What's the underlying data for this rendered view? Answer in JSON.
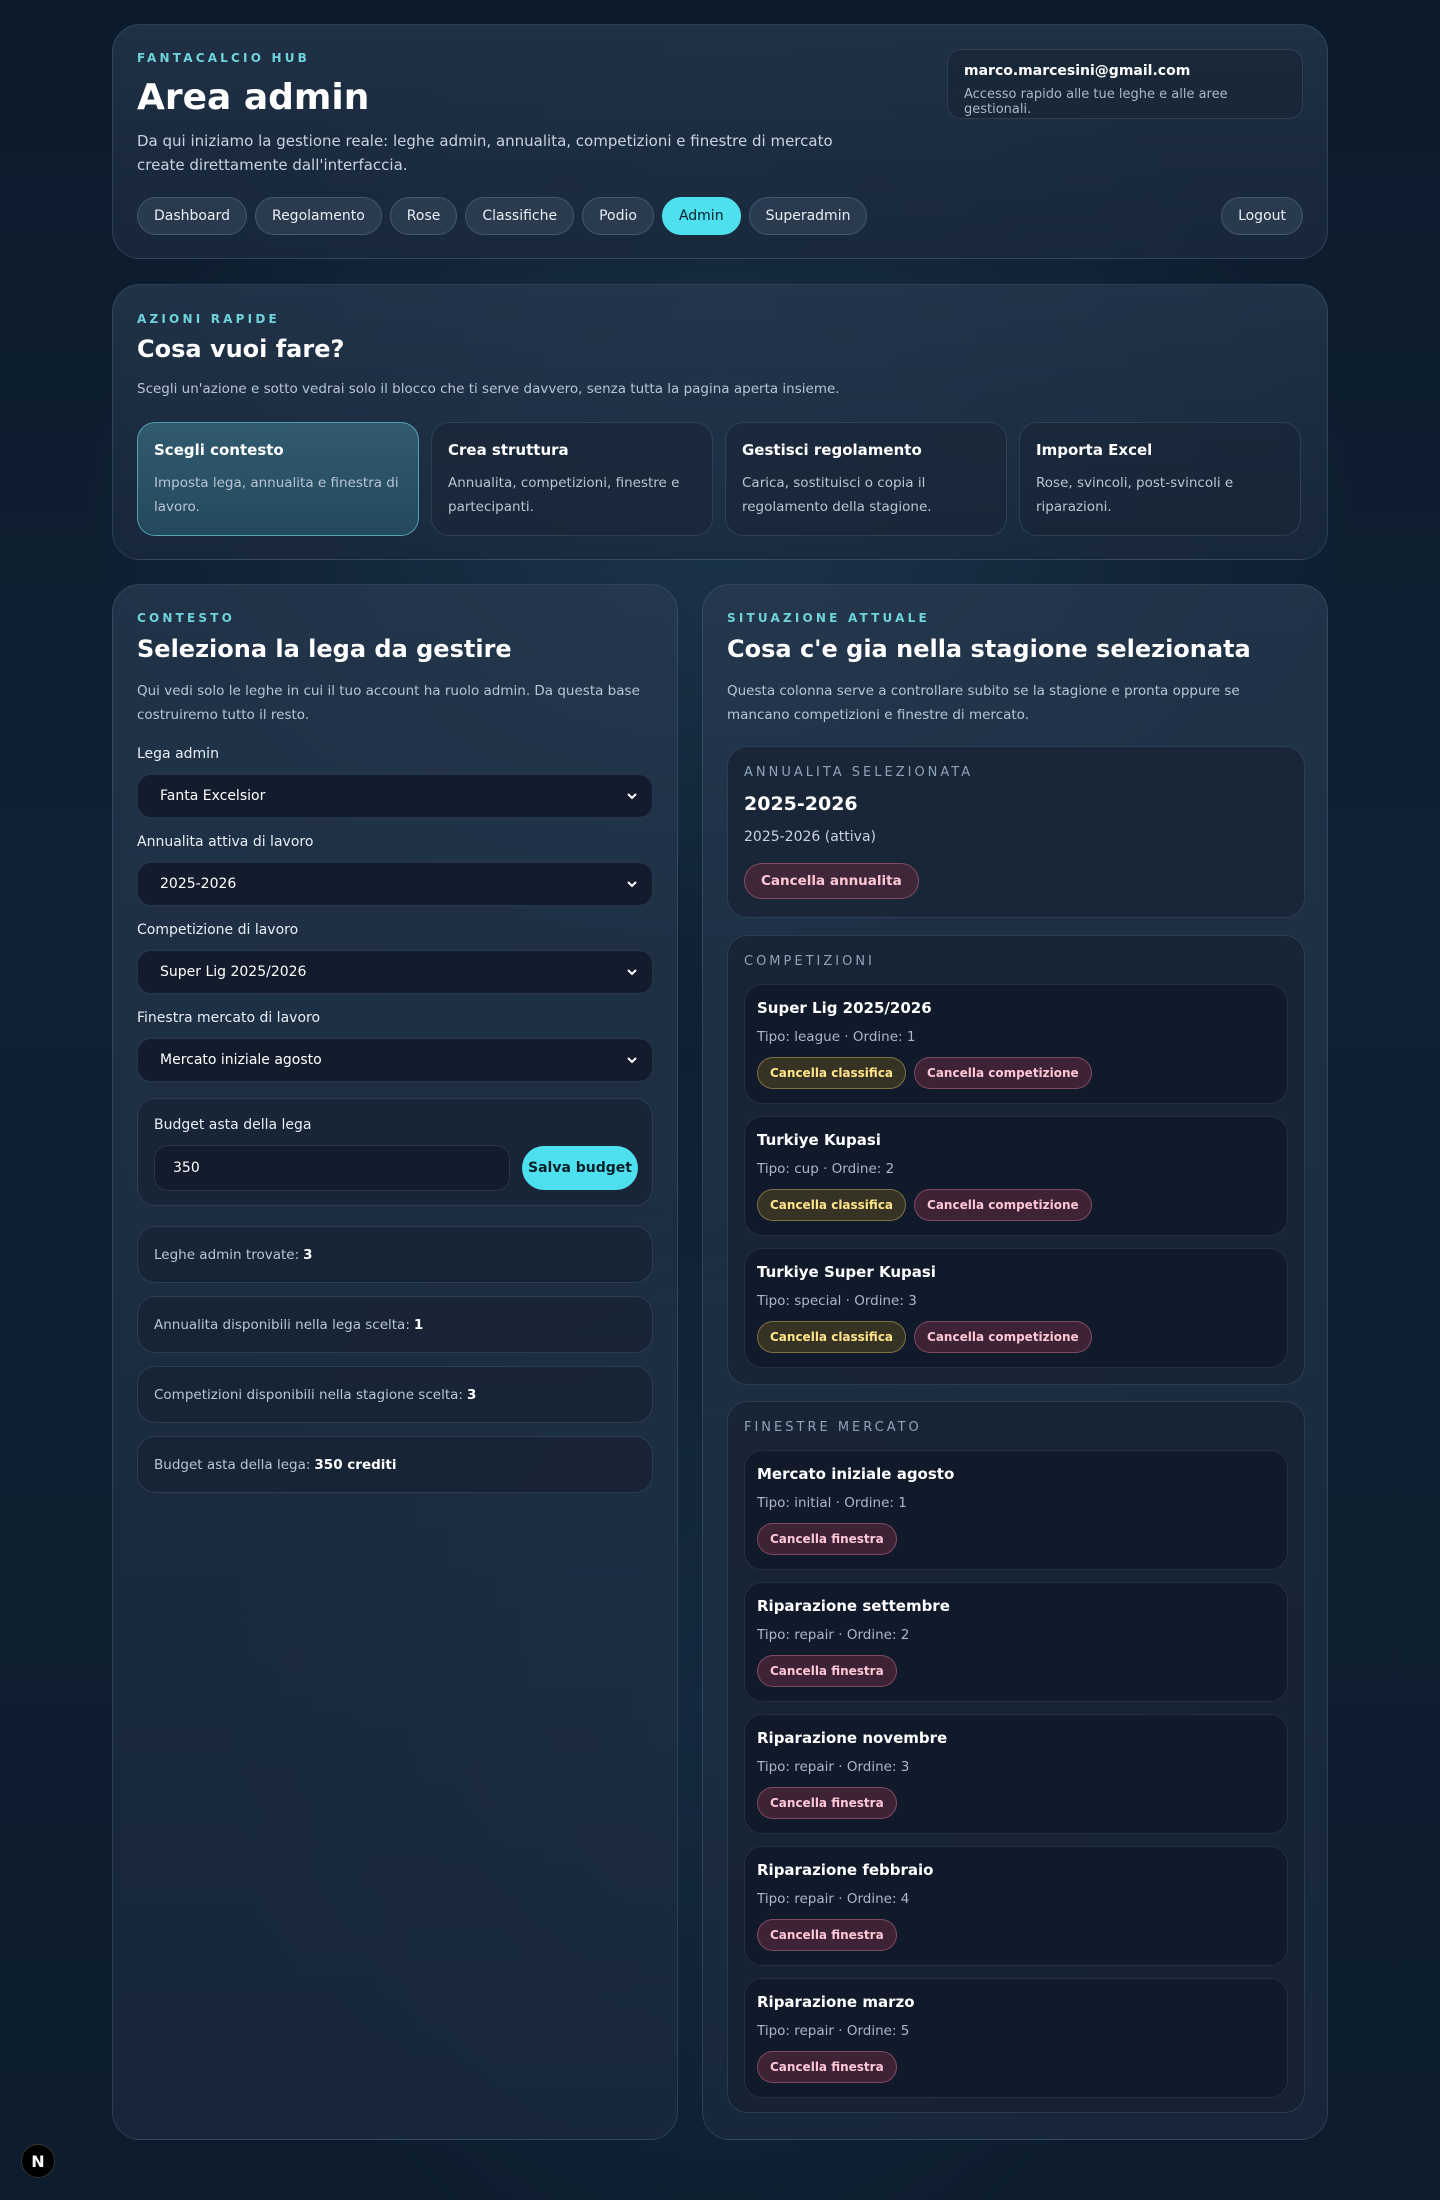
{
  "header": {
    "eyebrow": "FANTACALCIO HUB",
    "title": "Area admin",
    "description": "Da qui iniziamo la gestione reale: leghe admin, annualita, competizioni e finestre di mercato create direttamente dall'interfaccia.",
    "account_email": "marco.marcesini@gmail.com",
    "account_sub": "Accesso rapido alle tue leghe e alle aree gestionali.",
    "nav": [
      "Dashboard",
      "Regolamento",
      "Rose",
      "Classifiche",
      "Podio",
      "Admin",
      "Superadmin"
    ],
    "active_nav": "Admin",
    "logout_label": "Logout"
  },
  "quick": {
    "eyebrow": "AZIONI RAPIDE",
    "title": "Cosa vuoi fare?",
    "description": "Scegli un'azione e sotto vedrai solo il blocco che ti serve davvero, senza tutta la pagina aperta insieme.",
    "cards": [
      {
        "title": "Scegli contesto",
        "desc": "Imposta lega, annualita e finestra di lavoro."
      },
      {
        "title": "Crea struttura",
        "desc": "Annualita, competizioni, finestre e partecipanti."
      },
      {
        "title": "Gestisci regolamento",
        "desc": "Carica, sostituisci o copia il regolamento della stagione."
      },
      {
        "title": "Importa Excel",
        "desc": "Rose, svincoli, post-svincoli e riparazioni."
      }
    ]
  },
  "context": {
    "eyebrow": "CONTESTO",
    "title": "Seleziona la lega da gestire",
    "description": "Qui vedi solo le leghe in cui il tuo account ha ruolo admin. Da questa base costruiremo tutto il resto.",
    "league_label": "Lega admin",
    "league_value": "Fanta Excelsior",
    "annuality_label": "Annualita attiva di lavoro",
    "annuality_value": "2025-2026",
    "competition_label": "Competizione di lavoro",
    "competition_value": "Super Lig 2025/2026",
    "window_label": "Finestra mercato di lavoro",
    "window_value": "Mercato iniziale agosto",
    "budget_label": "Budget asta della lega",
    "budget_value": "350",
    "save_budget_label": "Salva budget",
    "stats": [
      {
        "label": "Leghe admin trovate:",
        "value": "3"
      },
      {
        "label": "Annualita disponibili nella lega scelta:",
        "value": "1"
      },
      {
        "label": "Competizioni disponibili nella stagione scelta:",
        "value": "3"
      },
      {
        "label": "Budget asta della lega:",
        "value": "350 crediti"
      }
    ]
  },
  "situation": {
    "eyebrow": "SITUAZIONE ATTUALE",
    "title": "Cosa c'e gia nella stagione selezionata",
    "description": "Questa colonna serve a controllare subito se la stagione e pronta oppure se mancano competizioni e finestre di mercato.",
    "annuality": {
      "eyebrow": "ANNUALITA SELEZIONATA",
      "year": "2025-2026",
      "sub": "2025-2026 (attiva)",
      "delete_label": "Cancella annualita"
    },
    "competitions_eyebrow": "COMPETIZIONI",
    "competitions": [
      {
        "name": "Super Lig 2025/2026",
        "meta": "Tipo: league · Ordine: 1"
      },
      {
        "name": "Turkiye Kupasi",
        "meta": "Tipo: cup · Ordine: 2"
      },
      {
        "name": "Turkiye Super Kupasi",
        "meta": "Tipo: special · Ordine: 3"
      }
    ],
    "delete_standings_label": "Cancella classifica",
    "delete_competition_label": "Cancella competizione",
    "windows_eyebrow": "FINESTRE MERCATO",
    "windows": [
      {
        "name": "Mercato iniziale agosto",
        "meta": "Tipo: initial · Ordine: 1"
      },
      {
        "name": "Riparazione settembre",
        "meta": "Tipo: repair · Ordine: 2"
      },
      {
        "name": "Riparazione novembre",
        "meta": "Tipo: repair · Ordine: 3"
      },
      {
        "name": "Riparazione febbraio",
        "meta": "Tipo: repair · Ordine: 4"
      },
      {
        "name": "Riparazione marzo",
        "meta": "Tipo: repair · Ordine: 5"
      }
    ],
    "delete_window_label": "Cancella finestra"
  },
  "badge": {
    "letter": "N",
    "icon": "nextjs-icon"
  }
}
